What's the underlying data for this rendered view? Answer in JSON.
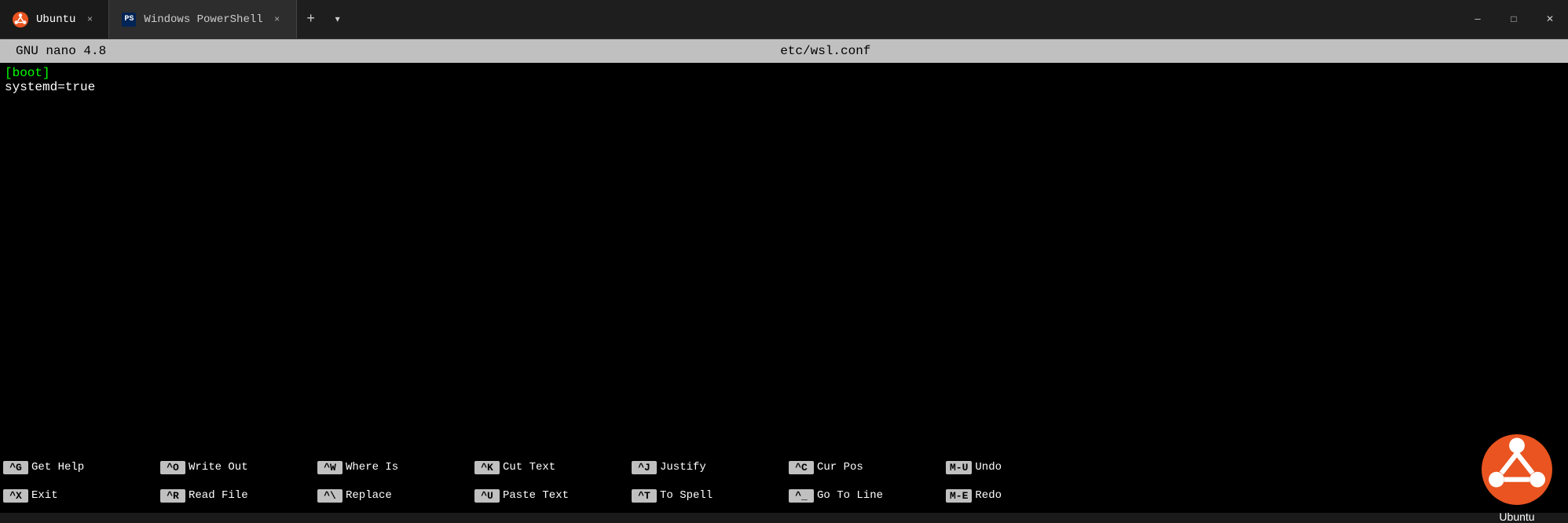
{
  "titlebar": {
    "tabs": [
      {
        "id": "ubuntu",
        "label": "Ubuntu",
        "icon_type": "ubuntu",
        "active": true,
        "close_label": "×"
      },
      {
        "id": "powershell",
        "label": "Windows PowerShell",
        "icon_type": "powershell",
        "active": false,
        "close_label": "×"
      }
    ],
    "add_tab_label": "+",
    "dropdown_label": "▾",
    "minimize_label": "─",
    "maximize_label": "□",
    "close_label": "✕"
  },
  "nano": {
    "header_left": "GNU nano 4.8",
    "header_center": "etc/wsl.conf",
    "content_lines": [
      {
        "text": "[boot]",
        "color": "green"
      },
      {
        "text": "systemd=true",
        "color": "white"
      }
    ]
  },
  "shortcuts": {
    "row1": [
      {
        "key": "^G",
        "label": "Get Help"
      },
      {
        "key": "^O",
        "label": "Write Out"
      },
      {
        "key": "^W",
        "label": "Where Is"
      },
      {
        "key": "^K",
        "label": "Cut Text"
      },
      {
        "key": "^J",
        "label": "Justify"
      },
      {
        "key": "^C",
        "label": "Cur Pos"
      },
      {
        "key": "M-U",
        "label": "Undo"
      }
    ],
    "row2": [
      {
        "key": "^X",
        "label": "Exit"
      },
      {
        "key": "^R",
        "label": "Read File"
      },
      {
        "key": "^\\",
        "label": "Replace"
      },
      {
        "key": "^U",
        "label": "Paste Text"
      },
      {
        "key": "^T",
        "label": "To Spell"
      },
      {
        "key": "^_",
        "label": "Go To Line"
      },
      {
        "key": "M-E",
        "label": "Redo"
      }
    ]
  },
  "ubuntu_brand": "Ubuntu"
}
